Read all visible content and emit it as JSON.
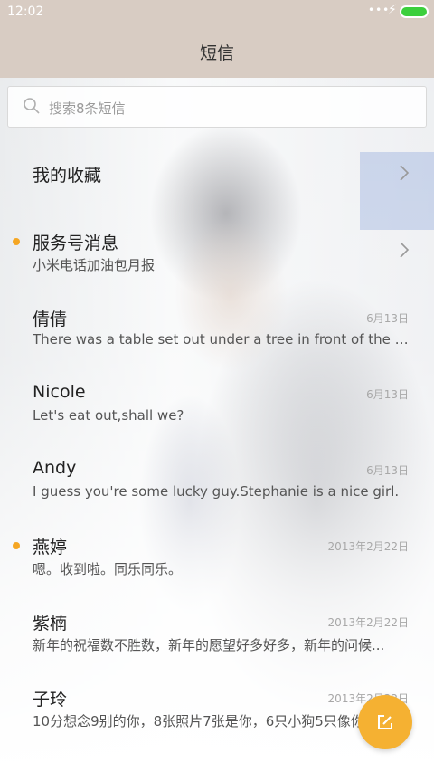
{
  "status_bar": {
    "time": "12:02"
  },
  "header": {
    "title": "短信"
  },
  "search": {
    "placeholder": "搜索8条短信"
  },
  "colors": {
    "accent": "#f5a623",
    "fab": "#f5b132",
    "header_bg": "#d8ccc3",
    "battery": "#3ccf3c"
  },
  "threads": [
    {
      "name": "我的收藏",
      "preview": "",
      "date": "",
      "unread": false,
      "chevron": true
    },
    {
      "name": "服务号消息",
      "preview": "小米电话加油包月报",
      "date": "",
      "unread": true,
      "chevron": true
    },
    {
      "name": "倩倩",
      "preview": "There was a table set out under a tree in front of the ho...",
      "date": "6月13日",
      "unread": false,
      "chevron": false
    },
    {
      "name": "Nicole",
      "preview": "Let's eat out,shall we?",
      "date": "6月13日",
      "unread": false,
      "chevron": false
    },
    {
      "name": "Andy",
      "preview": "I guess you're some lucky guy.Stephanie is a nice girl.",
      "date": "6月13日",
      "unread": false,
      "chevron": false
    },
    {
      "name": "燕婷",
      "preview": "嗯。收到啦。同乐同乐。",
      "date": "2013年2月22日",
      "unread": true,
      "chevron": false
    },
    {
      "name": "紫楠",
      "preview": "新年的祝福数不胜数，新年的愿望好多好多，新年的问候...",
      "date": "2013年2月22日",
      "unread": false,
      "chevron": false
    },
    {
      "name": "子玲",
      "preview": "10分想念9别的你，8张照片7张是你，6只小狗5只像你",
      "date": "2013年2月22日",
      "unread": false,
      "chevron": false
    }
  ],
  "icons": {
    "search": "search-icon",
    "chevron": "chevron-right-icon",
    "compose": "compose-icon",
    "battery": "battery-icon",
    "charging": "charging-icon"
  }
}
